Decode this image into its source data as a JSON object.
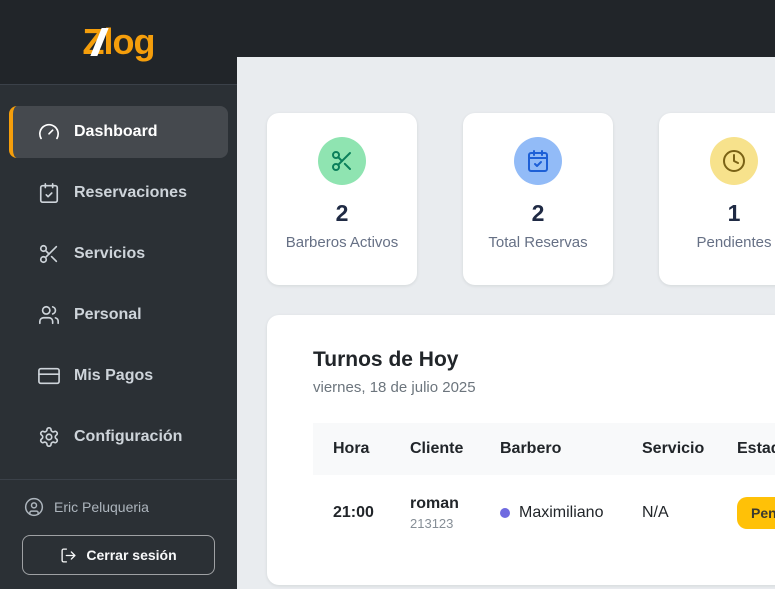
{
  "logo": {
    "z": "Z",
    "rest": "log",
    "accent_color": "#f59e0b"
  },
  "sidebar": {
    "items": [
      {
        "label": "Dashboard",
        "icon": "gauge-icon",
        "active": true
      },
      {
        "label": "Reservaciones",
        "icon": "calendar-check-icon",
        "active": false
      },
      {
        "label": "Servicios",
        "icon": "scissors-icon",
        "active": false
      },
      {
        "label": "Personal",
        "icon": "users-icon",
        "active": false
      },
      {
        "label": "Mis Pagos",
        "icon": "credit-card-icon",
        "active": false
      },
      {
        "label": "Configuración",
        "icon": "gear-icon",
        "active": false
      }
    ],
    "user": {
      "name": "Eric Peluqueria",
      "icon": "user-circle-icon"
    },
    "logout": {
      "label": "Cerrar sesión",
      "icon": "logout-icon"
    }
  },
  "stats": [
    {
      "value": "2",
      "label": "Barberos Activos",
      "icon": "scissors-icon",
      "icon_bg": "#8fe4b1",
      "icon_color": "#0b7f5b"
    },
    {
      "value": "2",
      "label": "Total Reservas",
      "icon": "calendar-check-icon",
      "icon_bg": "#92bbf7",
      "icon_color": "#1d5fd6"
    },
    {
      "value": "1",
      "label": "Pendientes",
      "icon": "clock-icon",
      "icon_bg": "#f7e28c",
      "icon_color": "#7a6215"
    }
  ],
  "turnos": {
    "title": "Turnos de Hoy",
    "subtitle": "viernes, 18 de julio 2025",
    "columns": [
      "Hora",
      "Cliente",
      "Barbero",
      "Servicio",
      "Estado"
    ],
    "rows": [
      {
        "hora": "21:00",
        "cliente": "roman",
        "cliente_id": "213123",
        "barbero": "Maximiliano",
        "barbero_dot_color": "#6f6ae0",
        "servicio": "N/A",
        "estado": "Pendiente",
        "estado_bg": "#ffc107"
      }
    ]
  }
}
